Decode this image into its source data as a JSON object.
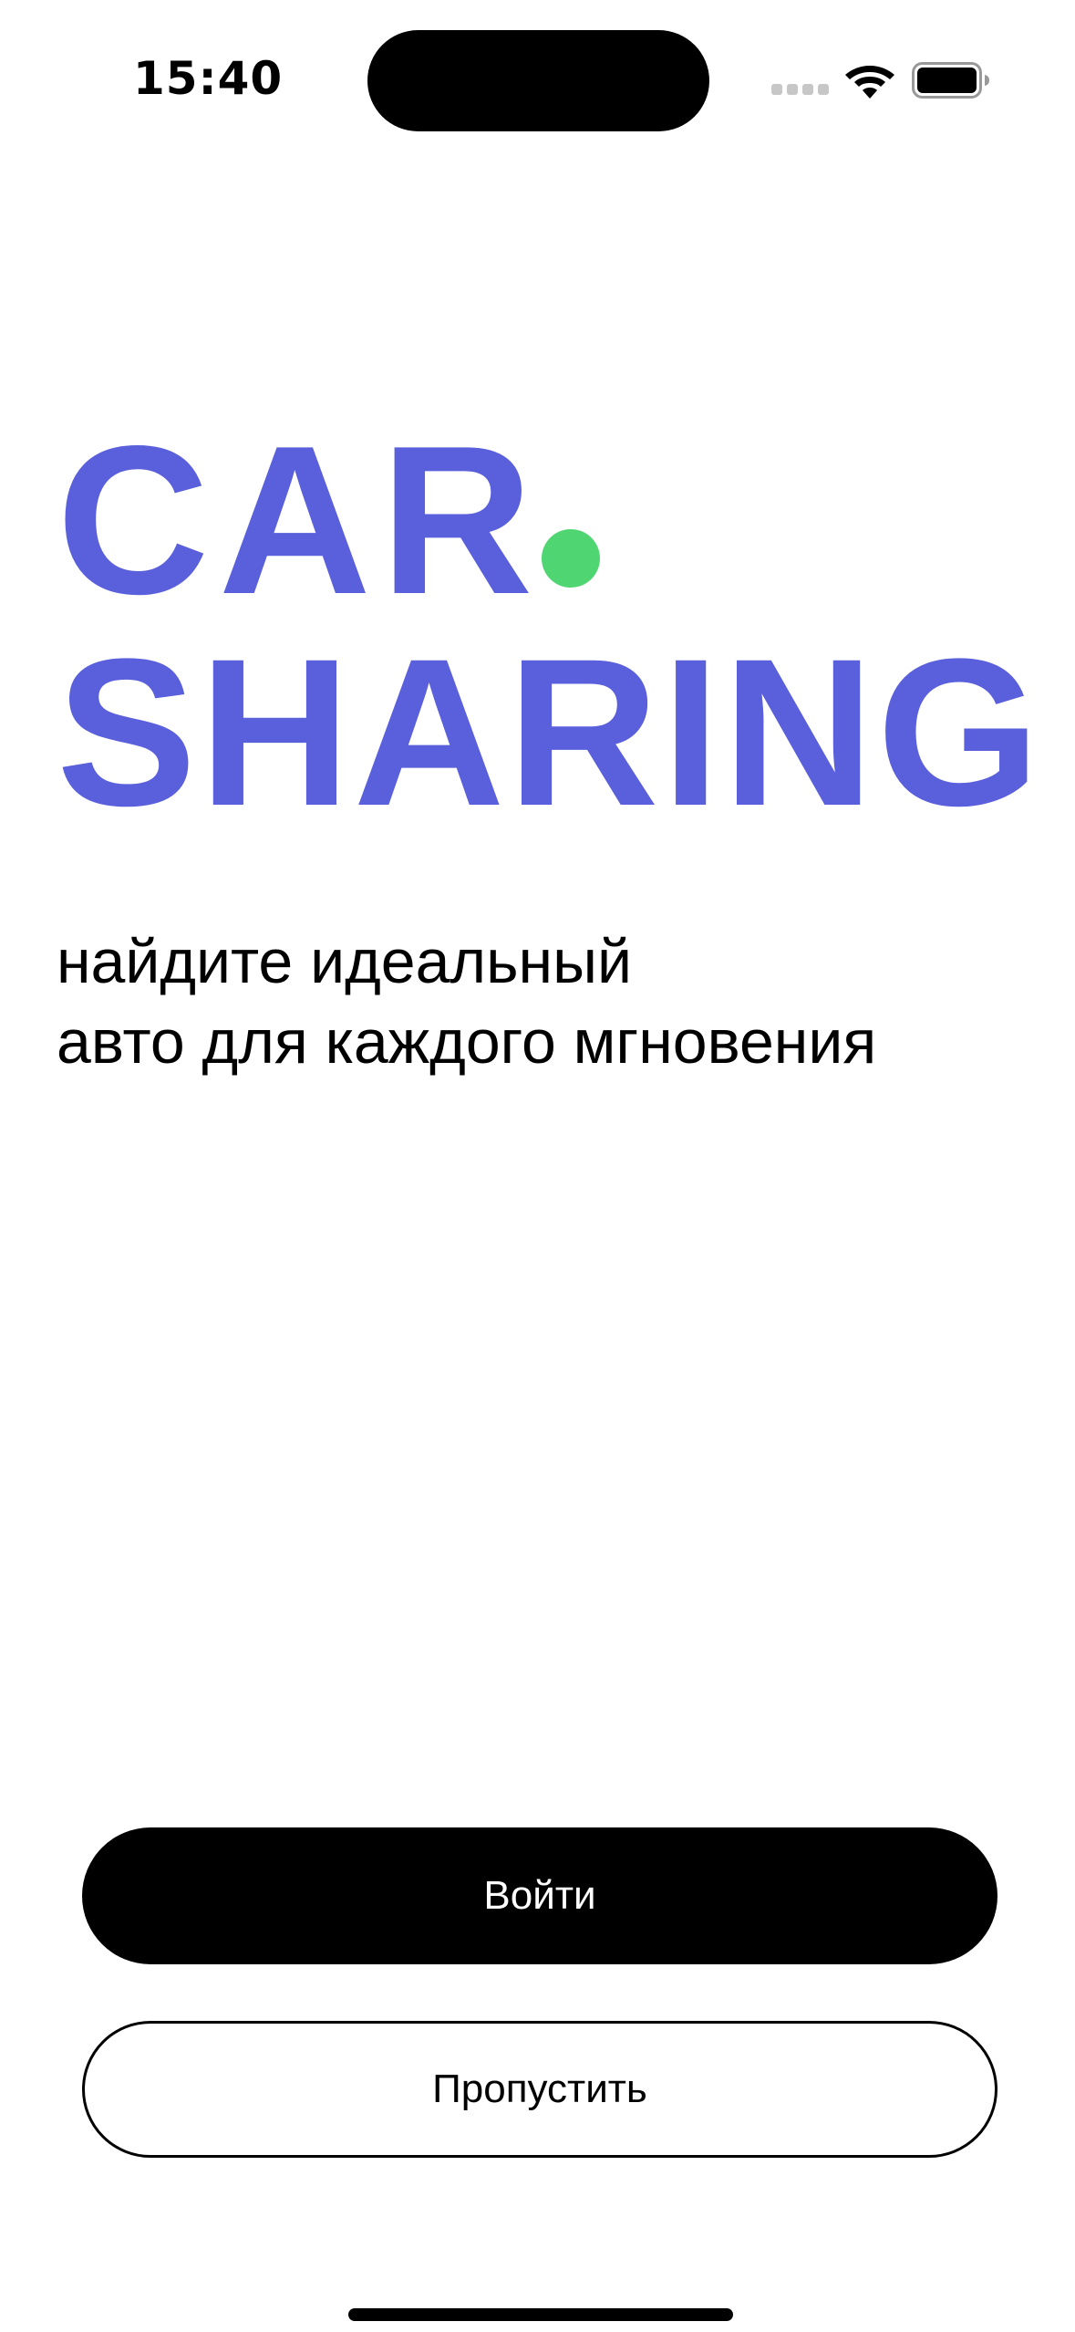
{
  "status_bar": {
    "time": "15:40",
    "icons": [
      "signal-icon",
      "wifi-icon",
      "battery-icon"
    ]
  },
  "logo": {
    "line1": "CAR",
    "line2": "SHARING",
    "text_color": "#5a5fdb",
    "dot_color": "#4fd672"
  },
  "tagline": {
    "line1": "найдите идеальный",
    "line2": "авто для каждого мгновения"
  },
  "actions": {
    "login_label": "Войти",
    "skip_label": "Пропустить"
  }
}
